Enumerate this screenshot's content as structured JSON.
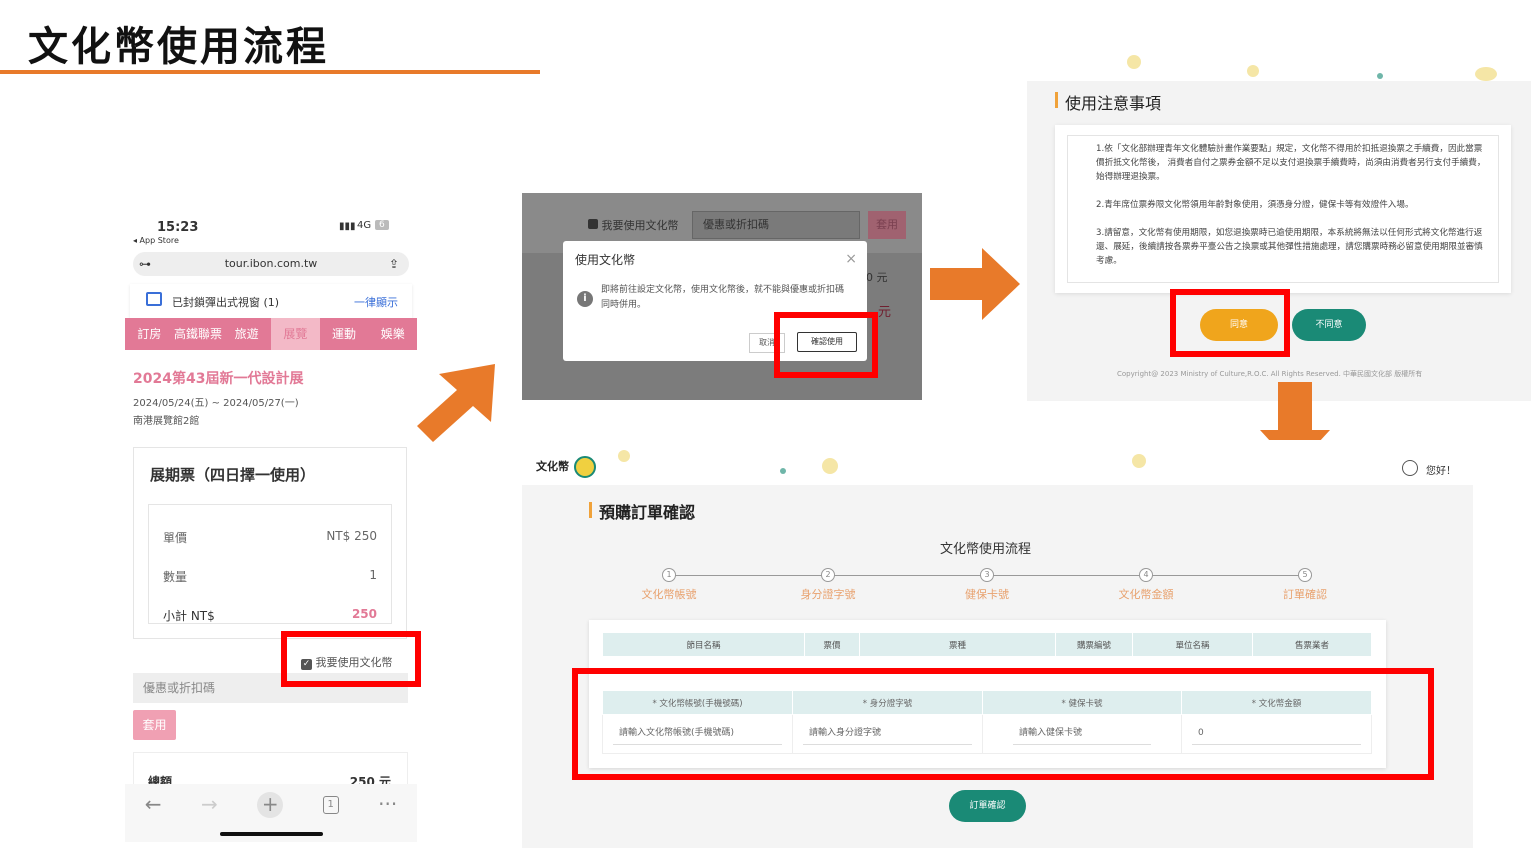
{
  "slide": {
    "title": "文化幣使用流程"
  },
  "phone": {
    "time": "15:23",
    "back": "◂ App Store",
    "signal": "4G",
    "battery": "6",
    "url": "tour.ibon.com.tw",
    "popup": "已封鎖彈出式視窗 (1)",
    "popup_action": "一律顯示",
    "nav": [
      "訂房",
      "高鐵聯票",
      "旅遊",
      "展覽",
      "運動",
      "娛樂"
    ],
    "event_title": "2024第43屆新一代設計展",
    "event_date": "2024/05/24(五) ~ 2024/05/27(一)",
    "event_venue": "南港展覽館2館",
    "ticket_title": "展期票（四日擇一使用）",
    "unit_label": "單價",
    "unit_value": "NT$ 250",
    "qty_label": "數量",
    "qty_value": "1",
    "subtotal_label": "小計 NT$",
    "subtotal_value": "250",
    "use_coin_label": "我要使用文化幣",
    "coupon_placeholder": "優惠或折扣碼",
    "apply": "套用",
    "total_label": "總額",
    "total_value": "250 元",
    "toolbar": [
      "←",
      "→",
      "+",
      "1",
      "···"
    ]
  },
  "modal": {
    "bg_check": "我要使用文化幣",
    "bg_coupon": "優惠或折扣碼",
    "bg_apply": "套用",
    "bg_price1": "0 元",
    "bg_price2": "元",
    "title": "使用文化幣",
    "close": "×",
    "message": "即將前往設定文化幣，使用文化幣後，就不能與優惠或折扣碼同時併用。",
    "cancel": "取消",
    "confirm": "確認使用"
  },
  "notice": {
    "title": "使用注意事項",
    "p1": "1.依「文化部辦理青年文化體驗計畫作業要點」規定，文化幣不得用於扣抵退換票之手續費，因此當票價折抵文化幣後， 消費者自付之票券金額不足以支付退換票手續費時，尚須由消費者另行支付手續費，始得辦理退換票。",
    "p2": "2.青年席位票券限文化幣領用年齡對象使用，須憑身分證，健保卡等有效證件入場。",
    "p3": "3.請留意，文化幣有使用期限，如您退換票時已逾使用期限，本系統將無法以任何形式將文化幣進行返還、展延，後續請按各票券平臺公告之換票或其他彈性措施處理，請您購票時務必留意使用期限並審慎考慮。",
    "agree": "同意",
    "disagree": "不同意",
    "copyright": "Copyright@ 2023 Ministry of Culture,R.O.C. All Rights Reserved. 中華民國文化部 版權所有"
  },
  "order": {
    "logo": "文化幣",
    "greeting": "您好！",
    "page_title": "預購訂單確認",
    "flow_title": "文化幣使用流程",
    "steps": [
      "文化幣帳號",
      "身分證字號",
      "健保卡號",
      "文化幣金額",
      "訂單確認"
    ],
    "step_nums": [
      "1",
      "2",
      "3",
      "4",
      "5"
    ],
    "table_headers": [
      "節目名稱",
      "票價",
      "票種",
      "購票編號",
      "單位名稱",
      "售票業者"
    ],
    "form_headers": [
      "* 文化幣帳號(手機號碼)",
      "* 身分證字號",
      "* 健保卡號",
      "* 文化幣金額"
    ],
    "form_placeholders": [
      "請輸入文化幣帳號(手機號碼)",
      "請輸入身分證字號",
      "請輸入健保卡號",
      "0"
    ],
    "submit": "訂單確認"
  },
  "colors": {
    "accent_orange": "#e87a2a",
    "pink": "#e27996",
    "teal": "#1a8a76",
    "highlight": "#ff0000"
  }
}
